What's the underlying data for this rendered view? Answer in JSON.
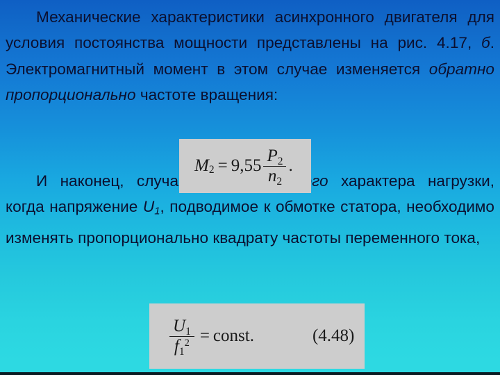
{
  "slide": {
    "background": {
      "gradient_from": "#0f5fc4",
      "gradient_mid": "#19a8e0",
      "gradient_to": "#2dd9e2"
    },
    "text_color": "#0b1030",
    "formula_box_color": "#cdcdcd"
  },
  "paragraph_1": {
    "part_1": "Механические характеристики асинхронного двигателя для условия постоянства мощности представлены на рис. 4.17, ",
    "fig_letter": "б",
    "part_2": ". Электромагнитный момент в этом случае изменяется ",
    "emphasis": "обратно пропорционально",
    "part_3": " частоте вращения:"
  },
  "paragraph_2": {
    "part_1": "И наконец, случай ",
    "emphasis": "вентиляторного",
    "part_2": " характера нагрузки, когда напряжение ",
    "variable": "U",
    "variable_sub": "1",
    "part_3": ", подводимое к обмотке статора, необходимо изменять пропорционально квадрату частоты переменного тока,"
  },
  "formula_1": {
    "lhs_symbol": "M",
    "lhs_sub": "2",
    "equals": "=",
    "coefficient": "9,55",
    "numerator_symbol": "P",
    "numerator_sub": "2",
    "denominator_symbol": "n",
    "denominator_sub": "2",
    "period": "."
  },
  "formula_2": {
    "numerator_symbol": "U",
    "numerator_sub": "1",
    "denominator_symbol": "f",
    "denominator_sub": "1",
    "denominator_sup": "2",
    "equals": "=",
    "rhs": "const.",
    "tag": "(4.48)"
  }
}
